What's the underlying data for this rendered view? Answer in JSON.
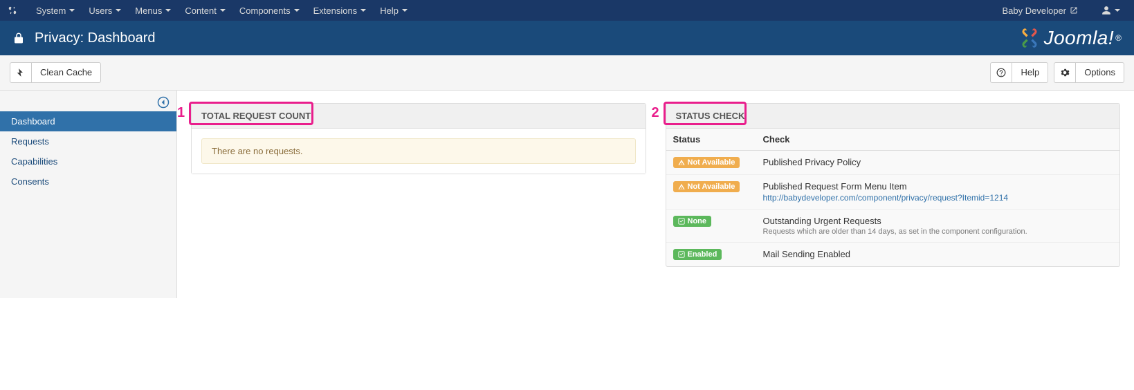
{
  "topnav": {
    "items": [
      "System",
      "Users",
      "Menus",
      "Content",
      "Components",
      "Extensions",
      "Help"
    ],
    "user": "Baby Developer"
  },
  "header": {
    "title": "Privacy: Dashboard",
    "brand": "Joomla!"
  },
  "toolbar": {
    "clean_cache": "Clean Cache",
    "help": "Help",
    "options": "Options"
  },
  "sidebar": {
    "items": [
      {
        "label": "Dashboard",
        "active": true
      },
      {
        "label": "Requests",
        "active": false
      },
      {
        "label": "Capabilities",
        "active": false
      },
      {
        "label": "Consents",
        "active": false
      }
    ]
  },
  "panels": {
    "request_count": {
      "title": "TOTAL REQUEST COUNT",
      "empty_msg": "There are no requests."
    },
    "status_check": {
      "title": "STATUS CHECK",
      "columns": {
        "status": "Status",
        "check": "Check"
      },
      "rows": [
        {
          "badge_type": "warning",
          "badge_icon": "alert",
          "badge_label": "Not Available",
          "check": "Published Privacy Policy"
        },
        {
          "badge_type": "warning",
          "badge_icon": "alert",
          "badge_label": "Not Available",
          "check": "Published Request Form Menu Item",
          "link": "http://babydeveloper.com/component/privacy/request?Itemid=1214"
        },
        {
          "badge_type": "success",
          "badge_icon": "check",
          "badge_label": "None",
          "check": "Outstanding Urgent Requests",
          "sub": "Requests which are older than 14 days, as set in the component configuration."
        },
        {
          "badge_type": "success",
          "badge_icon": "check",
          "badge_label": "Enabled",
          "check": "Mail Sending Enabled"
        }
      ]
    }
  },
  "annotations": {
    "one": "1",
    "two": "2"
  }
}
